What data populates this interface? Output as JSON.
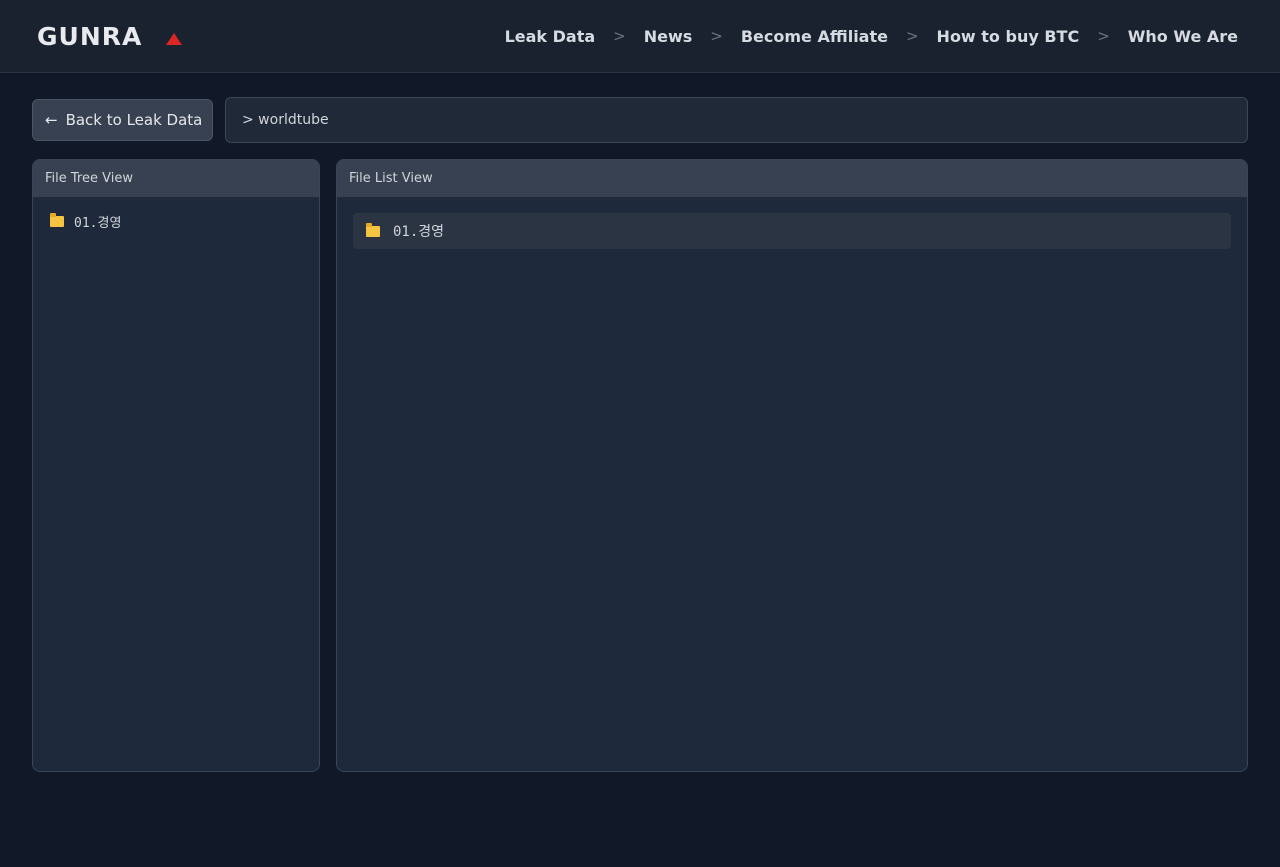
{
  "header": {
    "logo_text": "GUNRA",
    "nav": [
      {
        "label": "Leak Data"
      },
      {
        "label": "News"
      },
      {
        "label": "Become Affiliate"
      },
      {
        "label": "How to buy BTC"
      },
      {
        "label": "Who We Are"
      }
    ],
    "separator": ">"
  },
  "toolbar": {
    "back_arrow": "←",
    "back_label": "Back to Leak Data",
    "path": "> worldtube"
  },
  "tree_panel": {
    "title": "File Tree View",
    "items": [
      {
        "label": "01.경영",
        "icon": "folder-icon"
      }
    ]
  },
  "list_panel": {
    "title": "File List View",
    "items": [
      {
        "label": "01.경영",
        "icon": "folder-icon"
      }
    ]
  },
  "colors": {
    "background": "#111827",
    "topbar": "#1a2230",
    "panel": "#1e293b",
    "panel_header": "#374151",
    "logo_accent": "#dc2626",
    "folder": "#f5c542"
  }
}
